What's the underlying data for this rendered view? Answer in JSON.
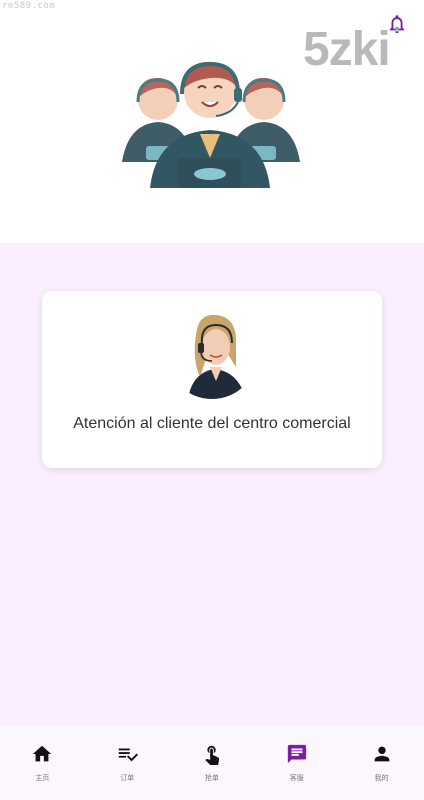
{
  "watermark": "re589.com",
  "brand": "5zki",
  "colors": {
    "accent": "#7b1fa2",
    "content_bg": "#fbeefe",
    "nav_bg": "#fcf7fd",
    "icon_default": "#111111"
  },
  "service_card": {
    "label": "Atención al cliente del centro comercial"
  },
  "bottom_nav": {
    "active_index": 3,
    "items": [
      {
        "label": "主页",
        "icon": "home-icon"
      },
      {
        "label": "订单",
        "icon": "playlist-check-icon"
      },
      {
        "label": "抢单",
        "icon": "touch-icon"
      },
      {
        "label": "客服",
        "icon": "chat-icon"
      },
      {
        "label": "我的",
        "icon": "person-icon"
      }
    ]
  }
}
